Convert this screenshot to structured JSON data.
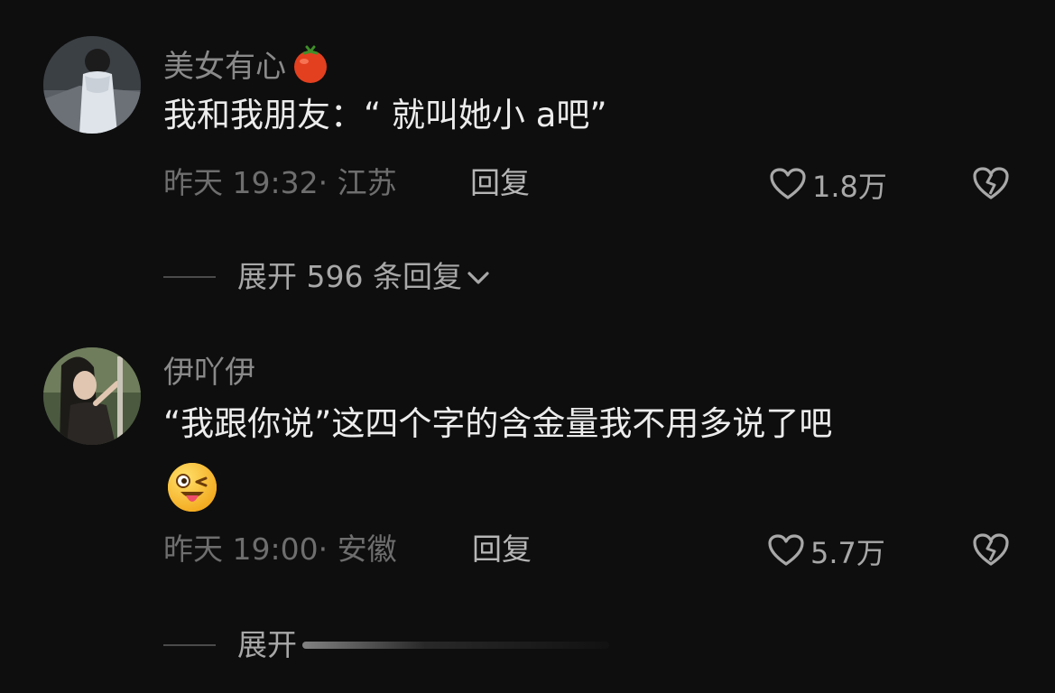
{
  "comments": [
    {
      "username": "美女有心",
      "text": "我和我朋友：“ 就叫她小 a吧”",
      "meta": "昨天 19:32· 江苏",
      "reply_label": "回复",
      "likes": "1.8万",
      "expand_label": "展开 596 条回复"
    },
    {
      "username": "伊吖伊",
      "text": "“我跟你说”这四个字的含金量我不用多说了吧",
      "meta": "昨天 19:00· 安徽",
      "reply_label": "回复",
      "likes": "5.7万",
      "expand_label": "展开"
    }
  ],
  "icons": {
    "username_badge": "tomato-icon",
    "emoji": "winking-tongue-emoji",
    "like": "heart-outline-icon",
    "dislike": "broken-heart-icon",
    "expand": "chevron-down-icon"
  },
  "colors": {
    "background": "#0e0e0e",
    "username": "#8a8a8a",
    "text": "#ececec",
    "meta": "#6e6e6e",
    "action": "#a8a8a8"
  }
}
